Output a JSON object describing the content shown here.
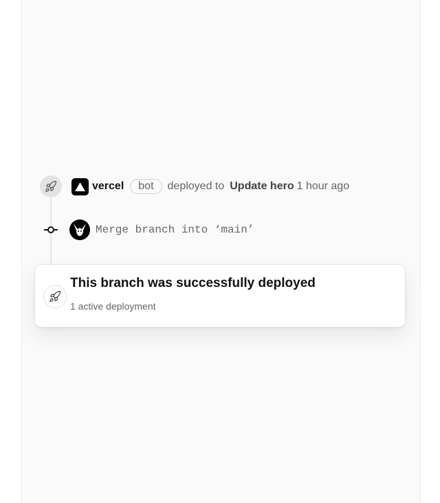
{
  "activity": {
    "actor_name": "vercel",
    "actor_badge": "bot",
    "action_text": "deployed to",
    "branch": "Update hero",
    "time_ago": "1 hour ago",
    "actor_icon": "vercel-triangle-icon",
    "event_icon": "rocket-icon"
  },
  "commit": {
    "message": "Merge branch into ‘main’",
    "node_icon": "git-commit-icon",
    "avatar_icon": "user-avatar"
  },
  "status_card": {
    "title": "This branch was successfully deployed",
    "subtitle": "1 active deployment",
    "icon": "rocket-icon"
  }
}
